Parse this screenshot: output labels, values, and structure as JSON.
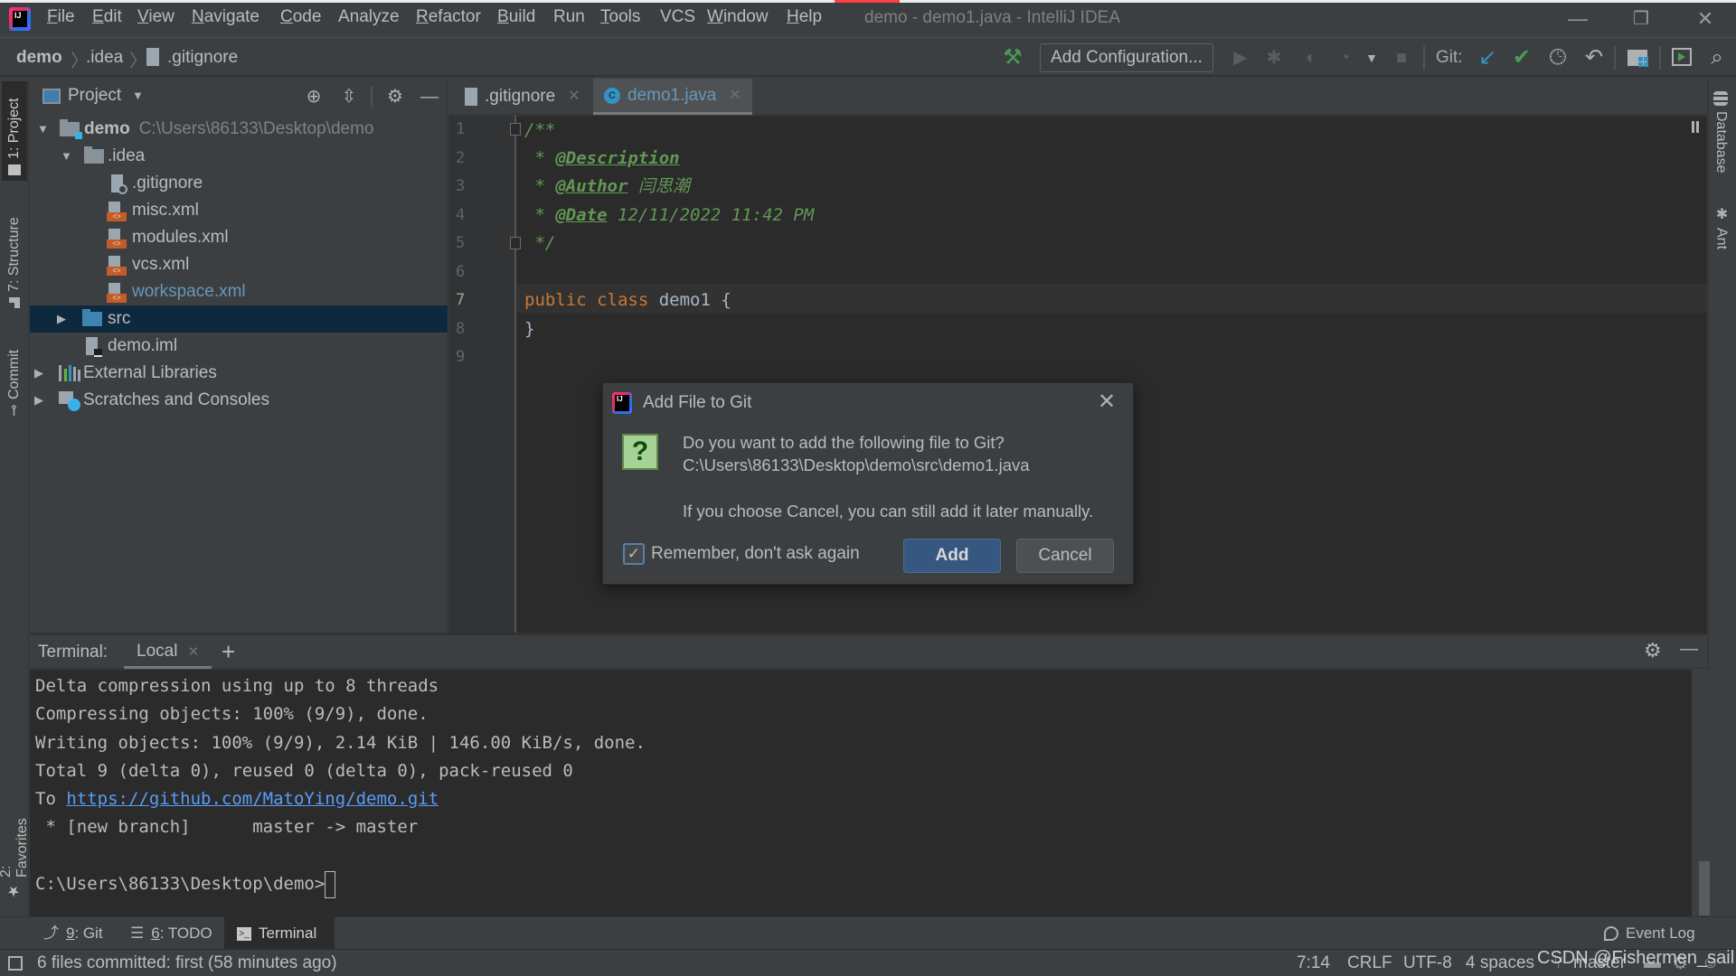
{
  "window": {
    "title": "demo - demo1.java - IntelliJ IDEA",
    "app_logo_text": "IJ",
    "controls": {
      "minimize": "—",
      "restore": "❐",
      "close": "✕"
    },
    "top_progress_color": "#ff4040"
  },
  "menu": [
    {
      "label": "File",
      "mnemonic": "F",
      "rest": "ile"
    },
    {
      "label": "Edit",
      "mnemonic": "E",
      "rest": "dit"
    },
    {
      "label": "View",
      "mnemonic": "V",
      "rest": "iew"
    },
    {
      "label": "Navigate",
      "mnemonic": "N",
      "rest": "avigate"
    },
    {
      "label": "Code",
      "mnemonic": "C",
      "rest": "ode"
    },
    {
      "label": "Analyze",
      "mnemonic": "",
      "rest": "Analyze"
    },
    {
      "label": "Refactor",
      "mnemonic": "R",
      "rest": "efactor"
    },
    {
      "label": "Build",
      "mnemonic": "B",
      "rest": "uild"
    },
    {
      "label": "Run",
      "mnemonic": "",
      "rest": "Run"
    },
    {
      "label": "Tools",
      "mnemonic": "T",
      "rest": "ools"
    },
    {
      "label": "VCS",
      "mnemonic": "",
      "rest": "VCS"
    },
    {
      "label": "Window",
      "mnemonic": "W",
      "rest": "indow"
    },
    {
      "label": "Help",
      "mnemonic": "H",
      "rest": "elp"
    }
  ],
  "breadcrumb": [
    "demo",
    ".idea",
    ".gitignore"
  ],
  "toolbar": {
    "add_configuration": "Add Configuration...",
    "git_label": "Git:",
    "icons": [
      "build-hammer",
      "run",
      "debug",
      "coverage",
      "profile",
      "stop",
      "git-update",
      "git-commit",
      "git-history",
      "git-rollback",
      "project-structure",
      "run-anything",
      "search-everywhere"
    ]
  },
  "left_stripe": {
    "project": "1: Project",
    "structure": "7: Structure",
    "commit": "Commit",
    "favorites": "2: Favorites"
  },
  "right_stripe": {
    "database": "Database",
    "ant": "Ant"
  },
  "project_panel": {
    "title": "Project",
    "tree": [
      {
        "label": "demo",
        "hint": "C:\\Users\\86133\\Desktop\\demo",
        "type": "module",
        "expanded": true
      },
      {
        "label": ".idea",
        "type": "folder",
        "expanded": true
      },
      {
        "label": ".gitignore",
        "type": "ignore-file"
      },
      {
        "label": "misc.xml",
        "type": "xml"
      },
      {
        "label": "modules.xml",
        "type": "xml"
      },
      {
        "label": "vcs.xml",
        "type": "xml"
      },
      {
        "label": "workspace.xml",
        "type": "xml",
        "modified": true
      },
      {
        "label": "src",
        "type": "source-folder",
        "expanded": false,
        "selected": true
      },
      {
        "label": "demo.iml",
        "type": "iml"
      },
      {
        "label": "External Libraries",
        "type": "libraries",
        "expanded": false
      },
      {
        "label": "Scratches and Consoles",
        "type": "scratches",
        "expanded": false
      }
    ]
  },
  "editor": {
    "tabs": [
      {
        "label": ".gitignore",
        "active": false
      },
      {
        "label": "demo1.java",
        "active": true
      }
    ],
    "line_numbers": [
      "1",
      "2",
      "3",
      "4",
      "5",
      "6",
      "7",
      "8",
      "9"
    ],
    "current_line": 7,
    "code": {
      "l1": "/**",
      "l2_star": " * ",
      "l2_tag": "@Description",
      "l3_star": " * ",
      "l3_tag": "@Author",
      "l3_val": " 闫思潮",
      "l4_star": " * ",
      "l4_tag": "@Date",
      "l4_val": " 12/11/2022 11:42 PM",
      "l5": " */",
      "l7_kw": "public class",
      "l7_name": " demo1 ",
      "l7_brace": "{",
      "l8": "}"
    }
  },
  "dialog": {
    "title": "Add File to Git",
    "question": "Do you want to add the following file to Git?",
    "path": "C:\\Users\\86133\\Desktop\\demo\\src\\demo1.java",
    "note": "If you choose Cancel, you can still add it later manually.",
    "remember_label": "Remember, don't ask again",
    "remember_checked": true,
    "add_label": "Add",
    "cancel_label": "Cancel"
  },
  "terminal": {
    "label": "Terminal:",
    "tab": "Local",
    "lines": [
      "Delta compression using up to 8 threads",
      "Compressing objects: 100% (9/9), done.",
      "Writing objects: 100% (9/9), 2.14 KiB | 146.00 KiB/s, done.",
      "Total 9 (delta 0), reused 0 (delta 0), pack-reused 0"
    ],
    "to_prefix": "To ",
    "remote_url": "https://github.com/MatoYing/demo.git",
    "branch_line": " * [new branch]      master -> master",
    "prompt": "C:\\Users\\86133\\Desktop\\demo>"
  },
  "bottom_tools": {
    "git": {
      "num": "9",
      "label": ": Git"
    },
    "todo": {
      "num": "6",
      "label": ": TODO"
    },
    "terminal": "Terminal",
    "event_log": "Event Log"
  },
  "status": {
    "message": "6 files committed: first (58 minutes ago)",
    "position": "7:14",
    "line_sep": "CRLF",
    "encoding": "UTF-8",
    "indent": "4 spaces",
    "branch": "master",
    "watermark": "CSDN @Fishermen_sail"
  }
}
